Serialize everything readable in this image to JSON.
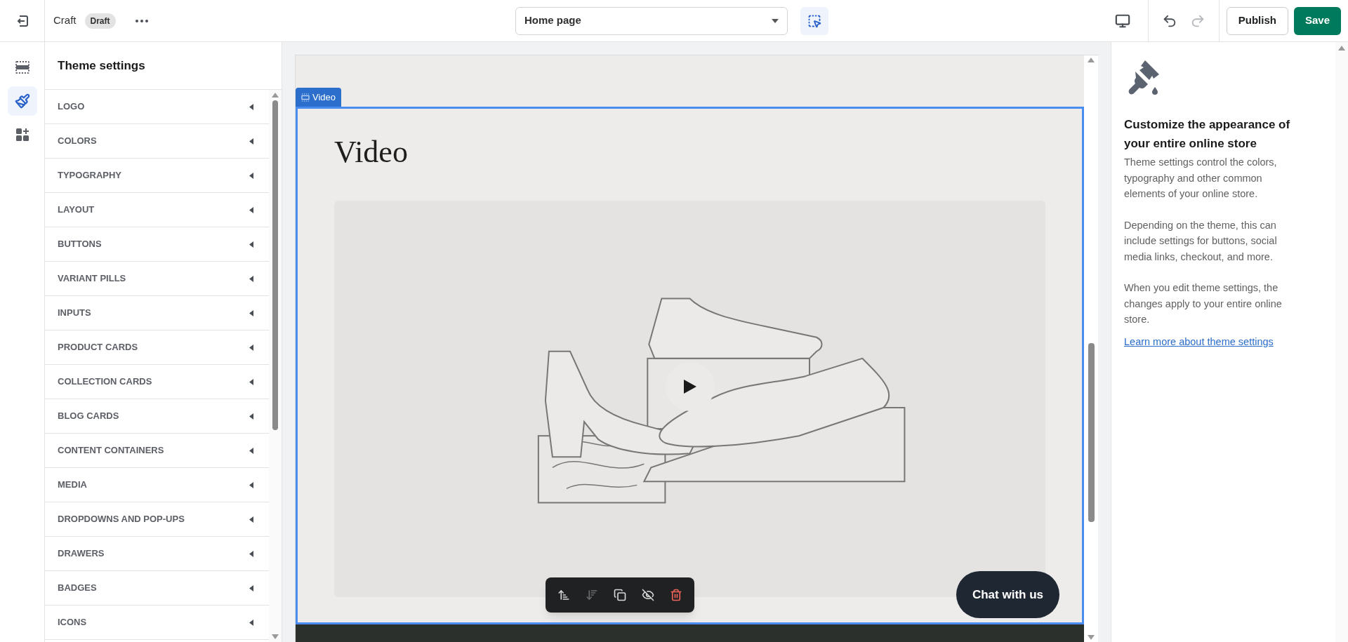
{
  "top_bar": {
    "store_name": "Craft",
    "status_badge": "Draft",
    "page_selector": {
      "value": "Home page"
    },
    "history": [
      {
        "kind": "undo",
        "disabled": false
      },
      {
        "kind": "redo",
        "disabled": true
      }
    ],
    "buttons": [
      {
        "kind": "secondary",
        "label": "Publish"
      },
      {
        "kind": "primary",
        "label": "Save"
      }
    ]
  },
  "icon_rail": [
    {
      "kind": "sections",
      "selected": false
    },
    {
      "kind": "theme",
      "selected": true
    },
    {
      "kind": "apps",
      "selected": false
    }
  ],
  "settings_panel": {
    "title": "Theme settings",
    "items": [
      {
        "label": "LOGO",
        "expanded": false
      },
      {
        "label": "COLORS",
        "expanded": false
      },
      {
        "label": "TYPOGRAPHY",
        "expanded": false
      },
      {
        "label": "LAYOUT",
        "expanded": false
      },
      {
        "label": "BUTTONS",
        "expanded": false
      },
      {
        "label": "VARIANT PILLS",
        "expanded": false
      },
      {
        "label": "INPUTS",
        "expanded": false
      },
      {
        "label": "PRODUCT CARDS",
        "expanded": false
      },
      {
        "label": "COLLECTION CARDS",
        "expanded": false
      },
      {
        "label": "BLOG CARDS",
        "expanded": false
      },
      {
        "label": "CONTENT CONTAINERS",
        "expanded": false
      },
      {
        "label": "MEDIA",
        "expanded": false
      },
      {
        "label": "DROPDOWNS AND POP-UPS",
        "expanded": false
      },
      {
        "label": "DRAWERS",
        "expanded": false
      },
      {
        "label": "BADGES",
        "expanded": false
      },
      {
        "label": "ICONS",
        "expanded": false
      }
    ]
  },
  "preview": {
    "section_label": "Video",
    "heading": "Video",
    "toolbar": [
      {
        "kind": "move-up",
        "disabled": false
      },
      {
        "kind": "move-down",
        "disabled": true
      },
      {
        "kind": "duplicate",
        "disabled": false
      },
      {
        "kind": "hide",
        "disabled": false
      },
      {
        "kind": "delete",
        "disabled": false
      }
    ],
    "chat_button": "Chat with us"
  },
  "info_panel": {
    "heading": "Customize the appearance of your entire online store",
    "paragraphs": [
      "Theme settings control the colors, typography and other common elements of your online store.",
      "Depending on the theme, this can include settings for buttons, social media links, checkout, and more.",
      "When you edit theme settings, the changes apply to your entire online store."
    ],
    "link": "Learn more about theme settings"
  }
}
